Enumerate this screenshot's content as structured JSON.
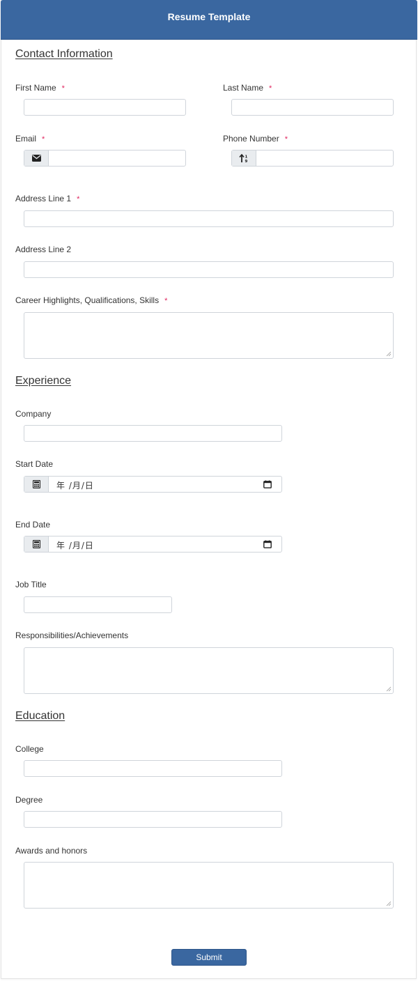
{
  "header": {
    "title": "Resume Template"
  },
  "sections": {
    "contact": "Contact Information",
    "experience": "Experience",
    "education": "Education"
  },
  "fields": {
    "first_name": {
      "label": "First Name",
      "required": "*",
      "value": ""
    },
    "last_name": {
      "label": "Last Name",
      "required": "*",
      "value": ""
    },
    "email": {
      "label": "Email",
      "required": "*",
      "value": "",
      "icon": "envelope-icon"
    },
    "phone": {
      "label": "Phone Number",
      "required": "*",
      "value": "",
      "icon": "sort-numeric-icon"
    },
    "address1": {
      "label": "Address Line 1",
      "required": "*",
      "value": ""
    },
    "address2": {
      "label": "Address Line 2",
      "value": ""
    },
    "career": {
      "label": "Career Highlights, Qualifications, Skills",
      "required": "*",
      "value": ""
    },
    "company": {
      "label": "Company",
      "value": ""
    },
    "start_date": {
      "label": "Start Date",
      "placeholder": "年 /月/日",
      "icon": "calculator-icon"
    },
    "end_date": {
      "label": "End Date",
      "placeholder": "年 /月/日",
      "icon": "calculator-icon"
    },
    "job_title": {
      "label": "Job Title",
      "value": ""
    },
    "responsibilities": {
      "label": "Responsibilities/Achievements",
      "value": ""
    },
    "college": {
      "label": "College",
      "value": ""
    },
    "degree": {
      "label": "Degree",
      "value": ""
    },
    "awards": {
      "label": "Awards and honors",
      "value": ""
    }
  },
  "submit": {
    "label": "Submit"
  },
  "colors": {
    "accent": "#3a67a0",
    "required": "#e0245e"
  }
}
